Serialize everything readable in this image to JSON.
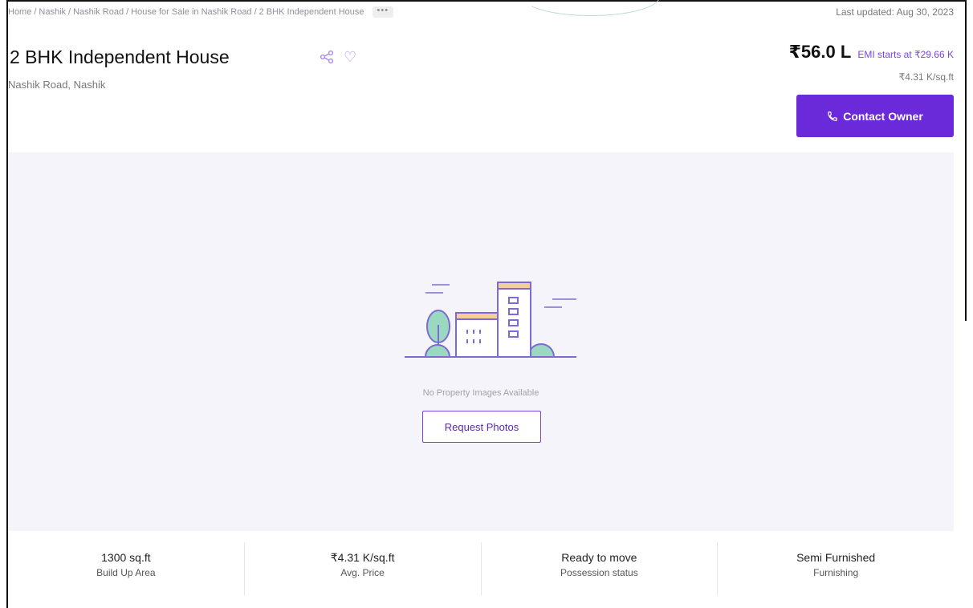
{
  "breadcrumb": {
    "items": [
      "Home",
      "Nashik",
      "Nashik Road",
      "House for Sale in Nashik Road",
      "2 BHK Independent House"
    ],
    "more_label": "•••"
  },
  "listing": {
    "last_updated": "Last updated: Aug 30, 2023",
    "title": "2 BHK Independent House",
    "location": "Nashik Road, Nashik",
    "price": "₹56.0 L",
    "emi": "EMI starts at ₹29.66 K",
    "price_per_sqft": "₹4.31 K/sq.ft",
    "contact_label": "Contact Owner"
  },
  "photos": {
    "empty_text": "No Property Images Available",
    "request_label": "Request Photos"
  },
  "stats": [
    {
      "value": "1300 sq.ft",
      "label": "Build Up Area"
    },
    {
      "value": "₹4.31 K/sq.ft",
      "label": "Avg. Price"
    },
    {
      "value": "Ready to move",
      "label": "Possession status"
    },
    {
      "value": "Semi Furnished",
      "label": "Furnishing"
    }
  ],
  "icons": {
    "share": "share-icon",
    "favorite": "heart-icon",
    "phone": "phone-icon"
  },
  "colors": {
    "accent": "#6a2ad9",
    "link": "#7b42e6",
    "photo_bg": "#f6f4fb"
  }
}
